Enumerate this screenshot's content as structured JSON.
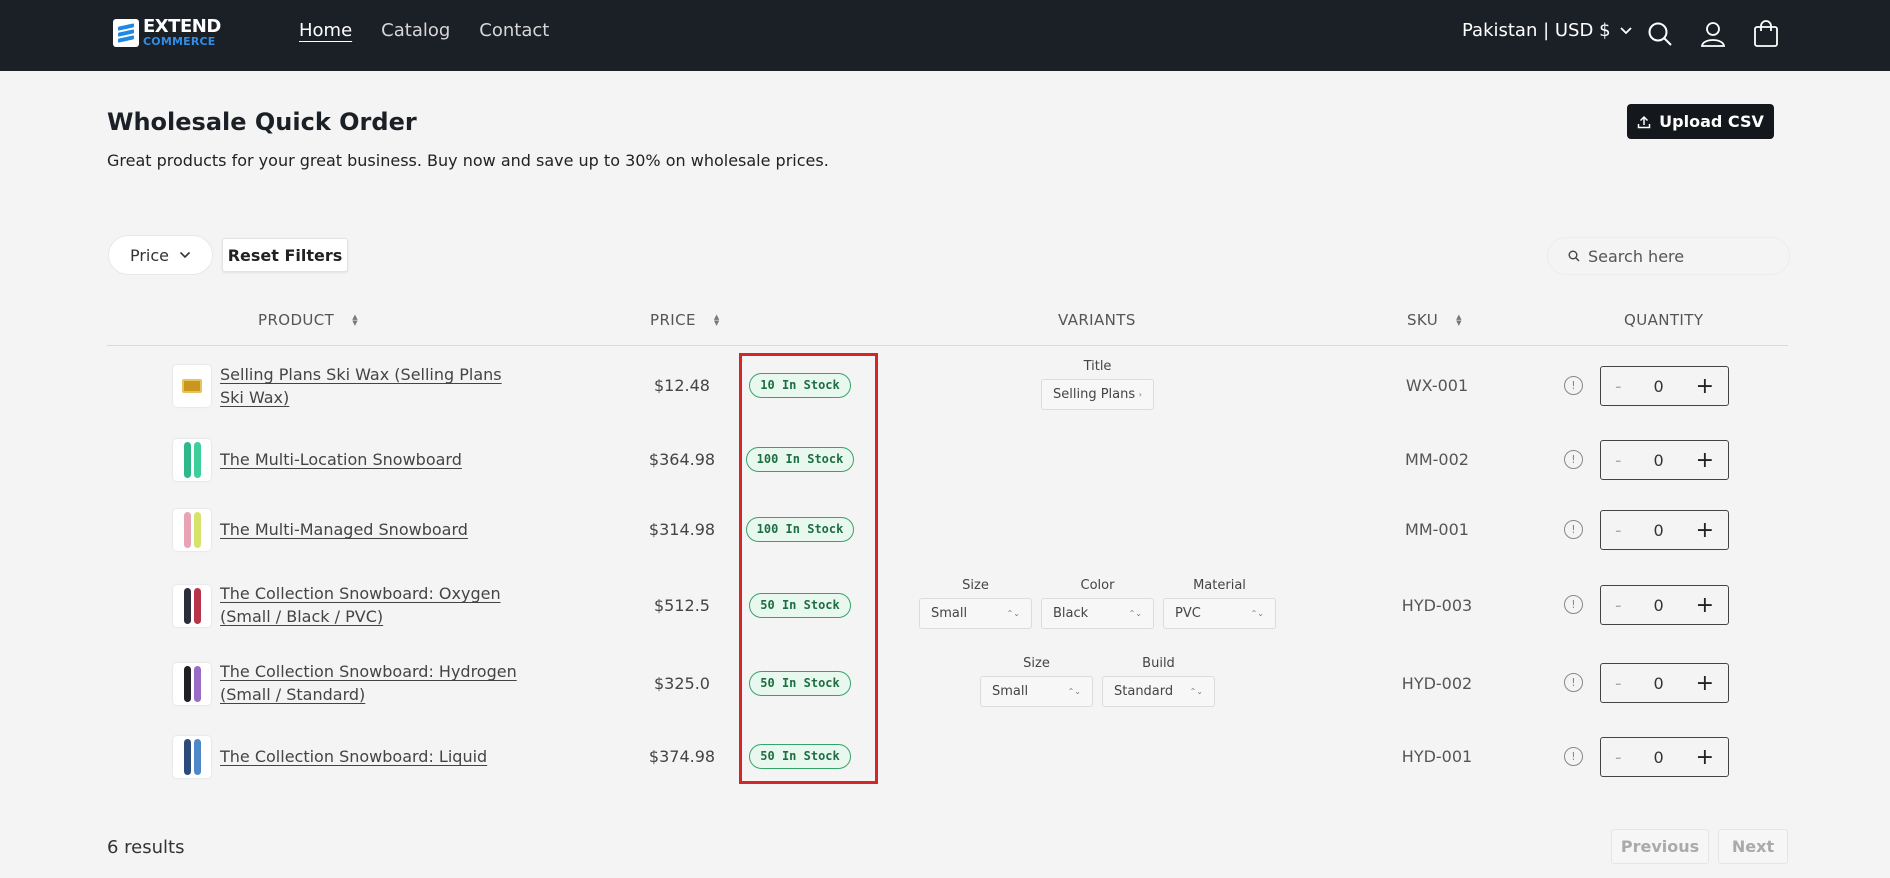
{
  "header": {
    "logo_line1": "EXTEND",
    "logo_line2": "COMMERCE",
    "nav": [
      "Home",
      "Catalog",
      "Contact"
    ],
    "locale": "Pakistan | USD $"
  },
  "page": {
    "title": "Wholesale Quick Order",
    "subtitle": "Great products for your great business. Buy now and save up to 30% on wholesale prices.",
    "upload_label": "Upload CSV"
  },
  "filters": {
    "price_label": "Price",
    "reset_label": "Reset Filters",
    "search_placeholder": "Search here"
  },
  "columns": {
    "product": "PRODUCT",
    "price": "PRICE",
    "variants": "VARIANTS",
    "sku": "SKU",
    "quantity": "QUANTITY"
  },
  "rows": [
    {
      "name_l1": "Selling Plans Ski Wax (Selling Plans",
      "name_l2": "Ski Wax)",
      "price": "$12.48",
      "stock": "10 In Stock",
      "sku": "WX-001",
      "qty": "0",
      "variants": [
        {
          "label": "Title",
          "value": "Selling Plans"
        }
      ]
    },
    {
      "name_l1": "The Multi-Location Snowboard",
      "name_l2": "",
      "price": "$364.98",
      "stock": "100 In Stock",
      "sku": "MM-002",
      "qty": "0",
      "variants": []
    },
    {
      "name_l1": "The Multi-Managed Snowboard",
      "name_l2": "",
      "price": "$314.98",
      "stock": "100 In Stock",
      "sku": "MM-001",
      "qty": "0",
      "variants": []
    },
    {
      "name_l1": "The Collection Snowboard: Oxygen",
      "name_l2": "(Small / Black / PVC)",
      "price": "$512.5",
      "stock": "50 In Stock",
      "sku": "HYD-003",
      "qty": "0",
      "variants": [
        {
          "label": "Size",
          "value": "Small"
        },
        {
          "label": "Color",
          "value": "Black"
        },
        {
          "label": "Material",
          "value": "PVC"
        }
      ]
    },
    {
      "name_l1": "The Collection Snowboard: Hydrogen",
      "name_l2": "(Small / Standard)",
      "price": "$325.0",
      "stock": "50 In Stock",
      "sku": "HYD-002",
      "qty": "0",
      "variants": [
        {
          "label": "Size",
          "value": "Small"
        },
        {
          "label": "Build",
          "value": "Standard"
        }
      ]
    },
    {
      "name_l1": "The Collection Snowboard: Liquid",
      "name_l2": "",
      "price": "$374.98",
      "stock": "50 In Stock",
      "sku": "HYD-001",
      "qty": "0",
      "variants": []
    }
  ],
  "qty_minus": "-",
  "qty_plus": "+",
  "info_glyph": "!",
  "footer": {
    "results": "6 results",
    "previous": "Previous",
    "next": "Next"
  },
  "colors": {
    "header_bg": "#1b1f26",
    "stock_green": "#35a46a",
    "highlight_red": "#d32626"
  }
}
